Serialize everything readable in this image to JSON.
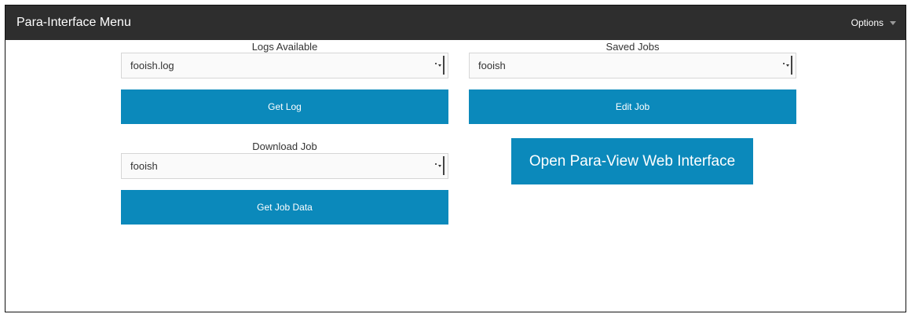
{
  "header": {
    "title": "Para-Interface Menu",
    "options_label": "Options"
  },
  "logs": {
    "label": "Logs Available",
    "selected": "fooish.log",
    "button": "Get Log"
  },
  "saved_jobs": {
    "label": "Saved Jobs",
    "selected": "fooish",
    "button": "Edit Job"
  },
  "download": {
    "label": "Download Job",
    "selected": "fooish",
    "button": "Get Job Data"
  },
  "paraview": {
    "button": "Open Para-View Web Interface"
  },
  "colors": {
    "topbar": "#2e2e2e",
    "button": "#0b89bb"
  }
}
